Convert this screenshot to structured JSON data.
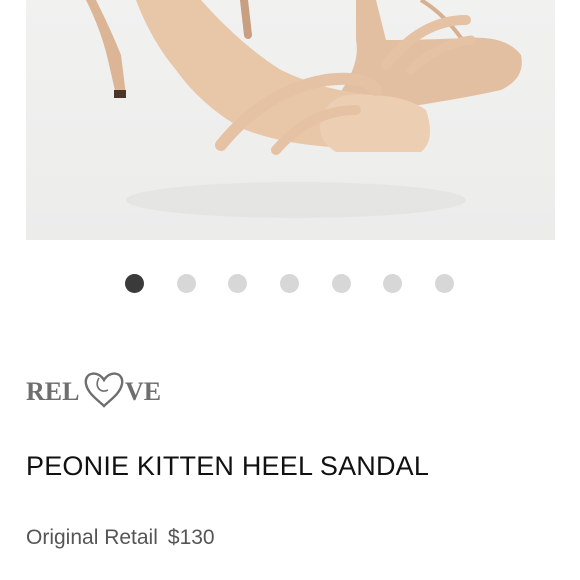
{
  "gallery": {
    "image_alt": "Nude patent kitten heel sandal",
    "slide_count": 7,
    "active_index": 0
  },
  "brand": {
    "logo_text": "RELOVE"
  },
  "product": {
    "title": "PEONIE KITTEN HEEL SANDAL",
    "retail_label": "Original Retail",
    "retail_price": "$130"
  },
  "colors": {
    "sandal": "#e8c6a8",
    "dot_active": "#3a3a3a",
    "dot_inactive": "#d7d7d7"
  }
}
